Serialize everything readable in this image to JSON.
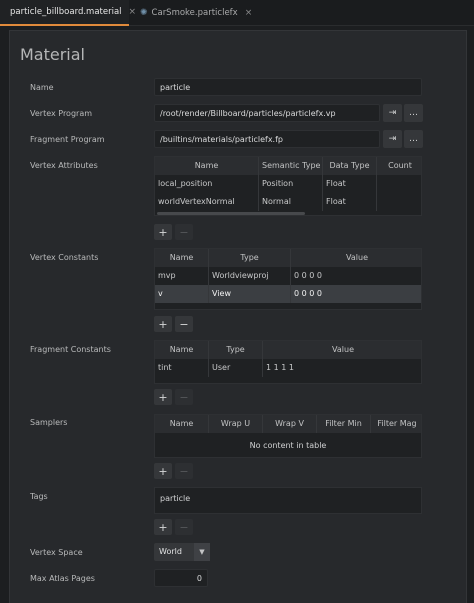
{
  "tabs": [
    {
      "label": "particle_billboard.material",
      "active": true,
      "icon": "material-icon",
      "color": "#4caf50"
    },
    {
      "label": "CarSmoke.particlefx",
      "active": false,
      "icon": "particlefx-icon",
      "color": "#6f8fa8"
    }
  ],
  "title": "Material",
  "name": {
    "label": "Name",
    "value": "particle"
  },
  "vertex_program": {
    "label": "Vertex Program",
    "value": "/root/render/Billboard/particles/particlefx.vp"
  },
  "fragment_program": {
    "label": "Fragment Program",
    "value": "/builtins/materials/particlefx.fp"
  },
  "vertex_attributes": {
    "label": "Vertex Attributes",
    "columns": [
      "Name",
      "Semantic Type",
      "Data Type",
      "Count"
    ],
    "rows": [
      [
        "local_position",
        "Position",
        "Float",
        ""
      ],
      [
        "worldVertexNormal",
        "Normal",
        "Float",
        ""
      ]
    ]
  },
  "vertex_constants": {
    "label": "Vertex Constants",
    "columns": [
      "Name",
      "Type",
      "Value"
    ],
    "rows": [
      [
        "mvp",
        "Worldviewproj",
        "0 0 0 0"
      ],
      [
        "v",
        "View",
        "0 0 0 0"
      ]
    ]
  },
  "fragment_constants": {
    "label": "Fragment Constants",
    "columns": [
      "Name",
      "Type",
      "Value"
    ],
    "rows": [
      [
        "tint",
        "User",
        "1 1 1 1"
      ]
    ]
  },
  "samplers": {
    "label": "Samplers",
    "columns": [
      "Name",
      "Wrap U",
      "Wrap V",
      "Filter Min",
      "Filter Mag"
    ],
    "empty_text": "No content in table"
  },
  "tags": {
    "label": "Tags",
    "value": "particle"
  },
  "vertex_space": {
    "label": "Vertex Space",
    "value": "World"
  },
  "max_atlas_pages": {
    "label": "Max Atlas Pages",
    "value": "0"
  },
  "buttons": {
    "add": "+",
    "remove": "−",
    "jump": "⇥",
    "browse": "…"
  }
}
